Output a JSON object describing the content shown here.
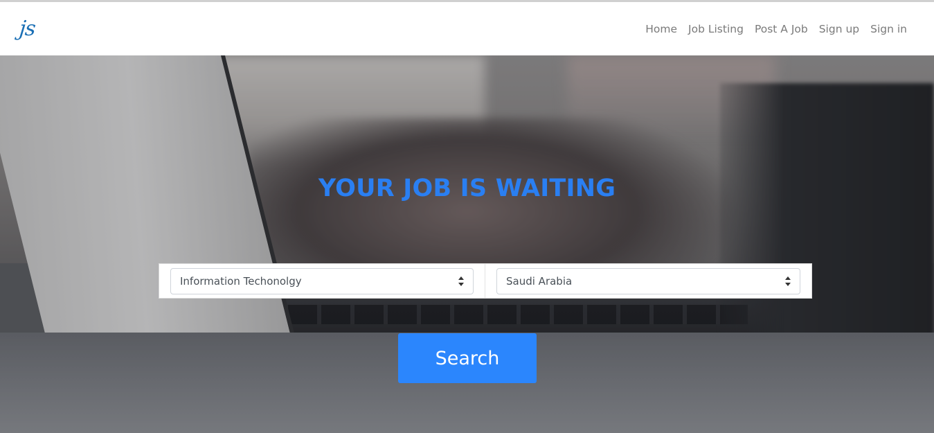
{
  "brand": {
    "logo_text": "js",
    "accent_color": "#1a6fb5"
  },
  "nav": {
    "items": [
      {
        "label": "Home"
      },
      {
        "label": "Job Listing"
      },
      {
        "label": "Post A Job"
      },
      {
        "label": "Sign up"
      },
      {
        "label": "Sign in"
      }
    ]
  },
  "hero": {
    "headline": "YOUR JOB IS WAITING",
    "headline_color": "#2a7ff2",
    "category_select": {
      "value": "Information Techonolgy"
    },
    "location_select": {
      "value": "Saudi Arabia"
    },
    "search_label": "Search",
    "search_color": "#2b86fd",
    "background_image": "laptop-typing-hands-photo"
  }
}
